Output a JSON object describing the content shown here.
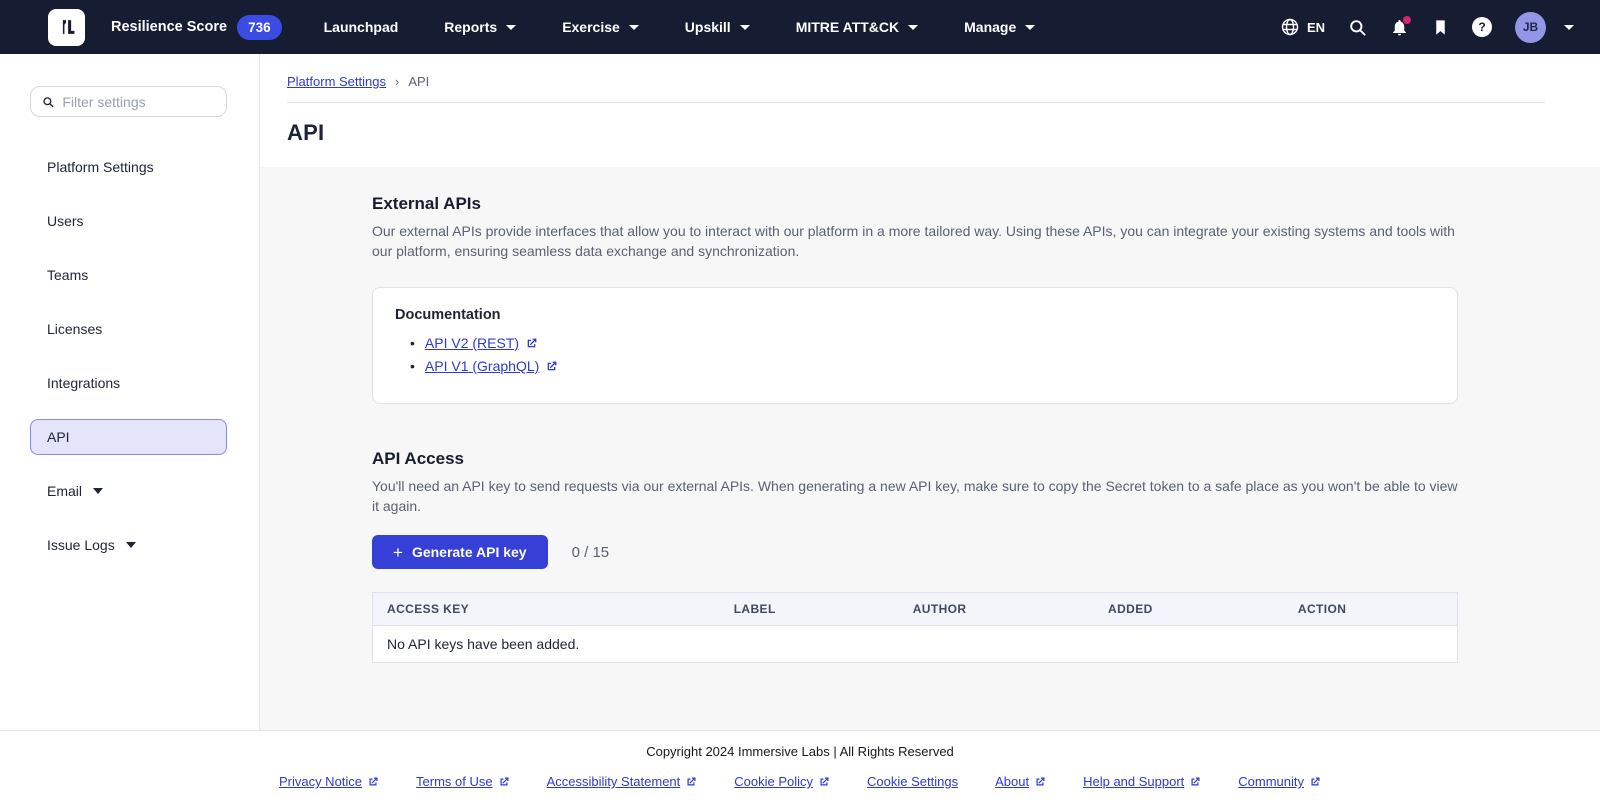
{
  "navbar": {
    "logo_name": "immersive-labs-logo",
    "resilience_score_label": "Resilience Score",
    "resilience_score_value": "736",
    "items": [
      {
        "label": "Launchpad"
      },
      {
        "label": "Reports"
      },
      {
        "label": "Exercise"
      },
      {
        "label": "Upskill"
      },
      {
        "label": "MITRE ATT&CK"
      },
      {
        "label": "Manage"
      }
    ],
    "language": "EN",
    "icon_names": [
      "globe-icon",
      "search-icon",
      "bell-icon",
      "bookmark-icon",
      "help-icon"
    ],
    "notification_unread_dot": true,
    "avatar_initials": "JB"
  },
  "sidebar": {
    "filter_placeholder": "Filter settings",
    "items": [
      {
        "label": "Platform Settings"
      },
      {
        "label": "Users"
      },
      {
        "label": "Teams"
      },
      {
        "label": "Licenses"
      },
      {
        "label": "Integrations"
      },
      {
        "label": "API",
        "selected": true
      },
      {
        "label": "Email",
        "expandable": true
      },
      {
        "label": "Issue Logs",
        "expandable": true
      }
    ]
  },
  "breadcrumb": {
    "parent": "Platform Settings",
    "separator": "›",
    "current": "API"
  },
  "page": {
    "title": "API"
  },
  "external_apis": {
    "heading": "External APIs",
    "description": "Our external APIs provide interfaces that allow you to interact with our platform in a more tailored way. Using these APIs, you can integrate your existing systems and tools with our platform, ensuring seamless data exchange and synchronization.",
    "documentation": {
      "heading": "Documentation",
      "bullet": "•",
      "links": [
        {
          "label": "API V2 (REST)",
          "external": true
        },
        {
          "label": "API V1 (GraphQL)",
          "external": true
        }
      ]
    }
  },
  "api_access": {
    "heading": "API Access",
    "description": "You'll need an API key to send requests via our external APIs. When generating a new API key, make sure to copy the Secret token to a safe place as you won't be able to view it again.",
    "generate_button_label": "Generate API key",
    "plus_glyph": "+",
    "key_count": "0 / 15",
    "table": {
      "columns": [
        "ACCESS KEY",
        "LABEL",
        "AUTHOR",
        "ADDED",
        "ACTION"
      ],
      "empty_message": "No API keys have been added."
    }
  },
  "footer": {
    "copyright": "Copyright 2024 Immersive Labs | All Rights Reserved",
    "links": [
      {
        "label": "Privacy Notice",
        "external": true
      },
      {
        "label": "Terms of Use",
        "external": true
      },
      {
        "label": "Accessibility Statement",
        "external": true
      },
      {
        "label": "Cookie Policy",
        "external": true
      },
      {
        "label": "Cookie Settings",
        "external": false
      },
      {
        "label": "About",
        "external": true
      },
      {
        "label": "Help and Support",
        "external": true
      },
      {
        "label": "Community",
        "external": true
      }
    ]
  },
  "colors": {
    "navbar_bg": "#161c31",
    "accent": "#3640d6",
    "badge_bg": "#3b4ce4",
    "link": "#2c3ad0",
    "selected_item_bg": "#e4e4fb",
    "selected_item_border": "#888ce8",
    "notification_dot": "#d6246e",
    "avatar_bg": "#9395e6",
    "content_bg": "#f7f7f8",
    "table_header_bg": "#f3f5fb"
  }
}
